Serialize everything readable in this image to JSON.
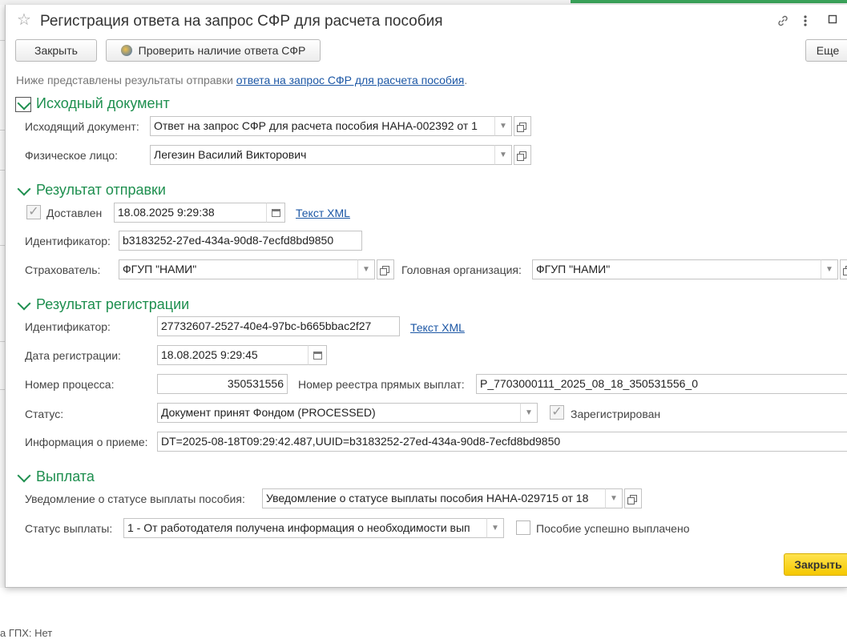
{
  "window": {
    "title": "Регистрация ответа на запрос СФР для расчета пособия"
  },
  "toolbar": {
    "close_label": "Закрыть",
    "check_label": "Проверить наличие ответа СФР",
    "more_label": "Еще"
  },
  "hint": {
    "prefix": "Ниже представлены результаты отправки ",
    "link": "ответа на запрос СФР для расчета пособия",
    "suffix": "."
  },
  "source_section": {
    "title": "Исходный документ",
    "outgoing_label": "Исходящий документ:",
    "outgoing_value": "Ответ на запрос СФР для расчета пособия НАНА-002392 от 1",
    "person_label": "Физическое лицо:",
    "person_value": "Легезин Василий Викторович"
  },
  "send_section": {
    "title": "Результат отправки",
    "delivered_label": "Доставлен",
    "delivered_checked": true,
    "delivered_date": "18.08.2025  9:29:38",
    "xml_link": "Текст XML",
    "id_label": "Идентификатор:",
    "id_value": "b3183252-27ed-434a-90d8-7ecfd8bd9850",
    "insurer_label": "Страхователь:",
    "insurer_value": "ФГУП \"НАМИ\"",
    "head_org_label": "Головная организация:",
    "head_org_value": "ФГУП \"НАМИ\""
  },
  "reg_section": {
    "title": "Результат регистрации",
    "id_label": "Идентификатор:",
    "id_value": "27732607-2527-40e4-97bc-b665bbac2f27",
    "xml_link": "Текст XML",
    "date_label": "Дата регистрации:",
    "date_value": "18.08.2025  9:29:45",
    "process_label": "Номер процесса:",
    "process_value": "350531556",
    "registry_label": "Номер реестра прямых выплат:",
    "registry_value": "P_7703000111_2025_08_18_350531556_0",
    "status_label": "Статус:",
    "status_value": "Документ принят Фондом (PROCESSED)",
    "registered_label": "Зарегистрирован",
    "registered_checked": true,
    "info_label": "Информация о приеме:",
    "info_value": "DT=2025-08-18T09:29:42.487,UUID=b3183252-27ed-434a-90d8-7ecfd8bd9850"
  },
  "payment_section": {
    "title": "Выплата",
    "notice_label": "Уведомление о статусе выплаты пособия:",
    "notice_value": "Уведомление о статусе выплаты пособия НАНА-029715 от 18",
    "status_label": "Статус выплаты:",
    "status_value": "1 - От работодателя получена информация о необходимости вып",
    "paid_label": "Пособие успешно выплачено",
    "paid_checked": false
  },
  "footer": {
    "close_label": "Закрыть"
  },
  "background": {
    "footer_text": "а ГПХ: Нет"
  },
  "colors": {
    "section_green": "#1e8f4f",
    "link_blue": "#1c57a5",
    "primary_button": "#f5c800"
  }
}
